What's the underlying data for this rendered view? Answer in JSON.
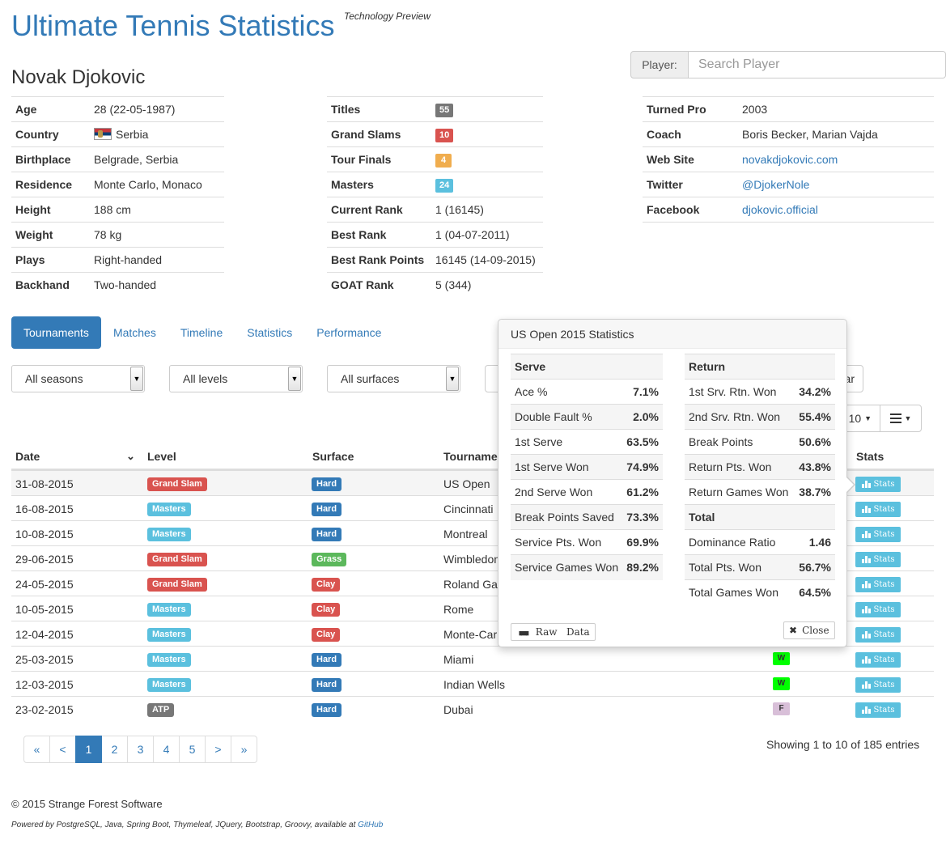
{
  "header": {
    "title": "Ultimate Tennis Statistics",
    "tag": "Technology Preview"
  },
  "search": {
    "label": "Player:",
    "placeholder": "Search Player"
  },
  "player": {
    "name": "Novak Djokovic",
    "personal": [
      {
        "key": "Age",
        "value": "28 (22-05-1987)"
      },
      {
        "key": "Country",
        "value": "Serbia"
      },
      {
        "key": "Birthplace",
        "value": "Belgrade, Serbia"
      },
      {
        "key": "Residence",
        "value": "Monte Carlo, Monaco"
      },
      {
        "key": "Height",
        "value": "188 cm"
      },
      {
        "key": "Weight",
        "value": "78 kg"
      },
      {
        "key": "Plays",
        "value": "Right-handed"
      },
      {
        "key": "Backhand",
        "value": "Two-handed"
      }
    ],
    "career": [
      {
        "key": "Titles",
        "badge": "55",
        "color": "#777777"
      },
      {
        "key": "Grand Slams",
        "badge": "10",
        "color": "#d9534f"
      },
      {
        "key": "Tour Finals",
        "badge": "4",
        "color": "#f0ad4e"
      },
      {
        "key": "Masters",
        "badge": "24",
        "color": "#5bc0de"
      },
      {
        "key": "Current Rank",
        "value": "1 (16145)"
      },
      {
        "key": "Best Rank",
        "value": "1 (04-07-2011)"
      },
      {
        "key": "Best Rank Points",
        "value": "16145 (14-09-2015)"
      },
      {
        "key": "GOAT Rank",
        "value": "5 (344)"
      }
    ],
    "misc": [
      {
        "key": "Turned Pro",
        "value": "2003"
      },
      {
        "key": "Coach",
        "value": "Boris Becker, Marian Vajda"
      },
      {
        "key": "Web Site",
        "value": "novakdjokovic.com",
        "link": true
      },
      {
        "key": "Twitter",
        "value": "@DjokerNole",
        "link": true
      },
      {
        "key": "Facebook",
        "value": "djokovic.official",
        "link": true
      }
    ]
  },
  "tabs": [
    "Tournaments",
    "Matches",
    "Timeline",
    "Statistics",
    "Performance"
  ],
  "filters": {
    "season": "All seasons",
    "level": "All levels",
    "surface": "All surfaces",
    "clear_partial": "ar",
    "page_size": "10"
  },
  "table": {
    "headers": {
      "date": "Date",
      "level": "Level",
      "surface": "Surface",
      "tournament": "Tourname",
      "stats": "Stats"
    },
    "stats_label": "Stats",
    "rows": [
      {
        "date": "31-08-2015",
        "level": "Grand Slam",
        "surface": "Hard",
        "tournament": "US Open",
        "result": ""
      },
      {
        "date": "16-08-2015",
        "level": "Masters",
        "surface": "Hard",
        "tournament": "Cincinnati",
        "result": ""
      },
      {
        "date": "10-08-2015",
        "level": "Masters",
        "surface": "Hard",
        "tournament": "Montreal",
        "result": ""
      },
      {
        "date": "29-06-2015",
        "level": "Grand Slam",
        "surface": "Grass",
        "tournament": "Wimbledon",
        "result": ""
      },
      {
        "date": "24-05-2015",
        "level": "Grand Slam",
        "surface": "Clay",
        "tournament": "Roland Ga",
        "result": ""
      },
      {
        "date": "10-05-2015",
        "level": "Masters",
        "surface": "Clay",
        "tournament": "Rome",
        "result": ""
      },
      {
        "date": "12-04-2015",
        "level": "Masters",
        "surface": "Clay",
        "tournament": "Monte-Car",
        "result": ""
      },
      {
        "date": "25-03-2015",
        "level": "Masters",
        "surface": "Hard",
        "tournament": "Miami",
        "result": "W"
      },
      {
        "date": "12-03-2015",
        "level": "Masters",
        "surface": "Hard",
        "tournament": "Indian Wells",
        "result": "W"
      },
      {
        "date": "23-02-2015",
        "level": "ATP",
        "surface": "Hard",
        "tournament": "Dubai",
        "result": "F"
      }
    ]
  },
  "colors": {
    "Grand Slam": "#d9534f",
    "Masters": "#5bc0de",
    "ATP": "#777777",
    "Hard": "#337ab7",
    "Grass": "#5cb85c",
    "Clay": "#d9534f",
    "W": "#00ff00",
    "F": "#d8bfd8"
  },
  "pagination": {
    "pages": [
      "«",
      "‹",
      "1",
      "2",
      "3",
      "4",
      "5",
      "›",
      "»"
    ],
    "first": "«",
    "prev": "<",
    "next": ">",
    "last": "»",
    "active": "1",
    "info": "Showing 1 to 10 of 185 entries"
  },
  "popover": {
    "title": "US Open 2015 Statistics",
    "serve_title": "Serve",
    "serve": [
      {
        "k": "Ace %",
        "v": "7.1%"
      },
      {
        "k": "Double Fault %",
        "v": "2.0%"
      },
      {
        "k": "1st Serve",
        "v": "63.5%"
      },
      {
        "k": "1st Serve Won",
        "v": "74.9%"
      },
      {
        "k": "2nd Serve Won",
        "v": "61.2%"
      },
      {
        "k": "Break Points Saved",
        "v": "73.3%"
      },
      {
        "k": "Service Pts. Won",
        "v": "69.9%"
      },
      {
        "k": "Service Games Won",
        "v": "89.2%"
      }
    ],
    "return_title": "Return",
    "return": [
      {
        "k": "1st Srv. Rtn. Won",
        "v": "34.2%"
      },
      {
        "k": "2nd Srv. Rtn. Won",
        "v": "55.4%"
      },
      {
        "k": "Break Points",
        "v": "50.6%"
      },
      {
        "k": "Return Pts. Won",
        "v": "43.8%"
      },
      {
        "k": "Return Games Won",
        "v": "38.7%"
      }
    ],
    "total_title": "Total",
    "total": [
      {
        "k": "Dominance Ratio",
        "v": "1.46"
      },
      {
        "k": "Total Pts. Won",
        "v": "56.7%"
      },
      {
        "k": "Total Games Won",
        "v": "64.5%"
      }
    ],
    "raw_label": "Raw   Data",
    "close_label": "Close"
  },
  "footer": {
    "copyright": "© 2015 Strange Forest Software",
    "powered": "Powered by PostgreSQL, Java, Spring Boot, Thymeleaf, JQuery, Bootstrap, Groovy, available at",
    "github": "GitHub"
  }
}
